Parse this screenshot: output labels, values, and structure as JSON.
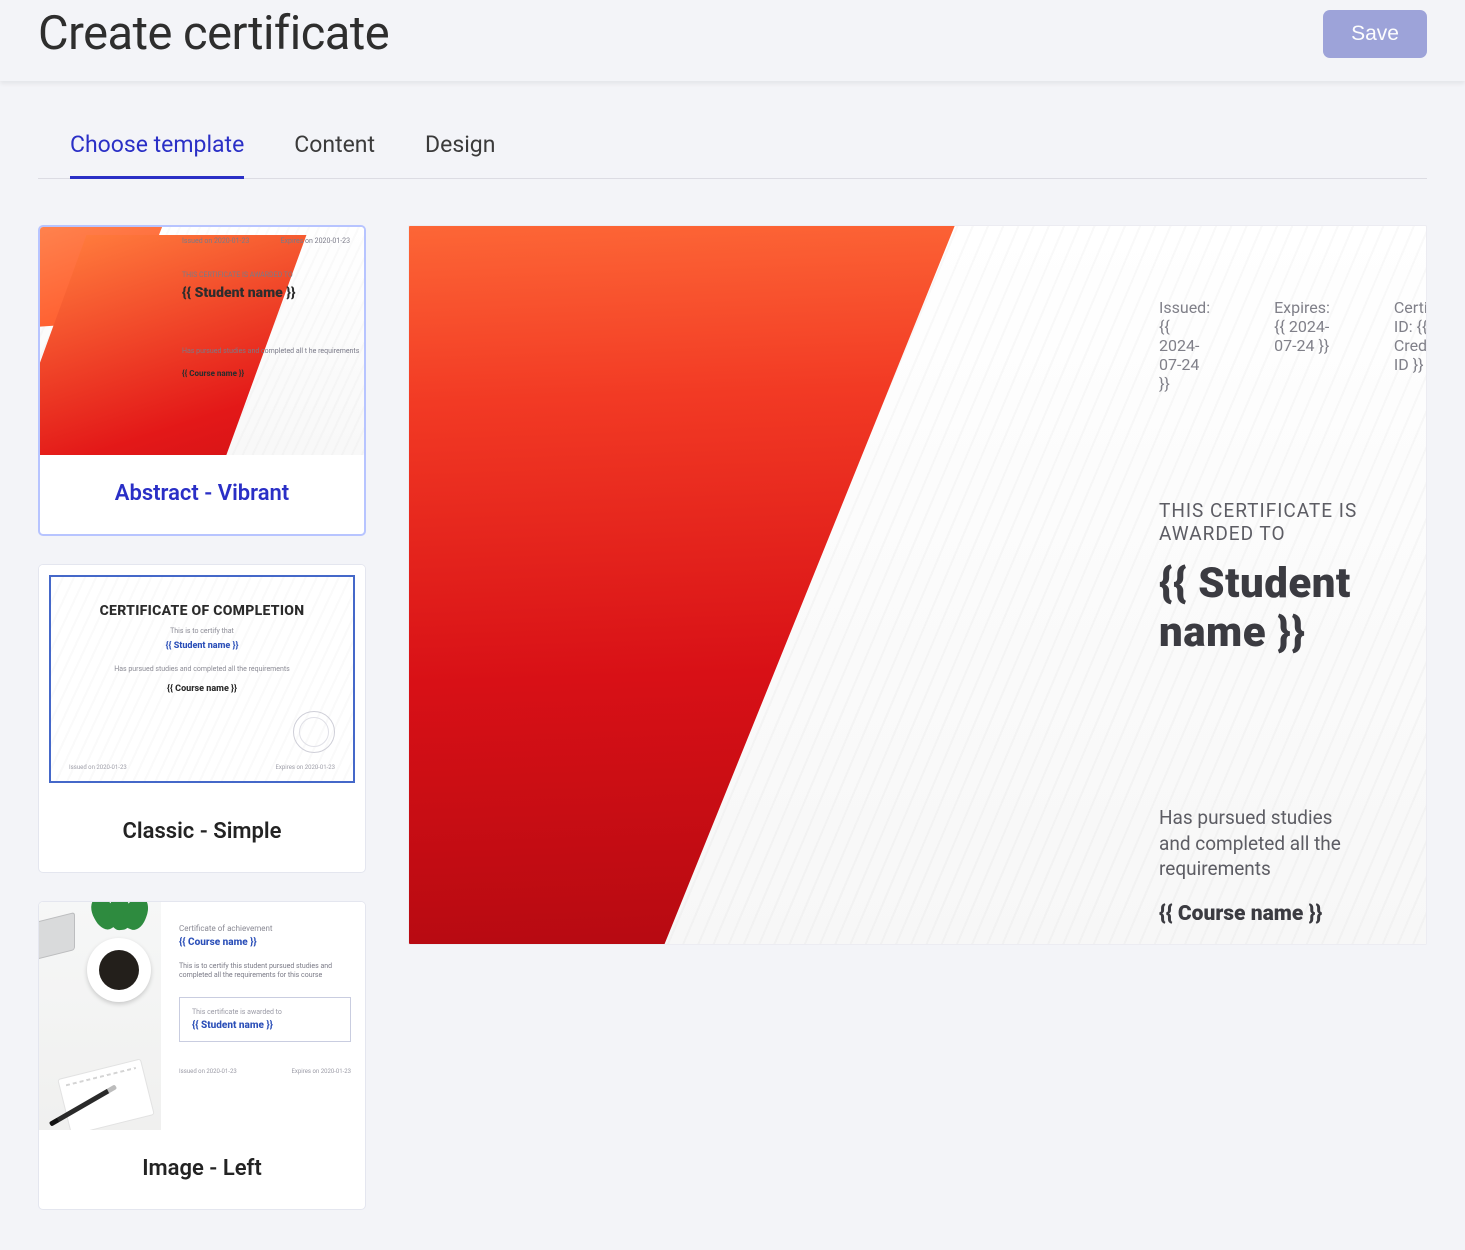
{
  "header": {
    "title": "Create certificate",
    "save_label": "Save"
  },
  "tabs": [
    {
      "label": "Choose template",
      "active": true
    },
    {
      "label": "Content",
      "active": false
    },
    {
      "label": "Design",
      "active": false
    }
  ],
  "templates": [
    {
      "name": "Abstract - Vibrant",
      "selected": true,
      "thumb": {
        "issued": "Issued on 2020-01-23",
        "expires": "Expires on 2020-01-23",
        "award_line": "THIS CERTIFICATE IS AWARDED TO",
        "student": "{{ Student name }}",
        "body": "Has pursued studies and completed all t he requirements",
        "course": "{{ Course name }}"
      }
    },
    {
      "name": "Classic - Simple",
      "selected": false,
      "thumb": {
        "title": "CERTIFICATE OF COMPLETION",
        "sub": "This is to certify that",
        "student": "{{ Student name }}",
        "body": "Has pursued studies and completed all the requirements",
        "course": "{{ Course name }}",
        "issued": "Issued on 2020-01-23",
        "expires": "Expires on 2020-01-23"
      }
    },
    {
      "name": "Image - Left",
      "selected": false,
      "thumb": {
        "sub": "Certificate of achievement",
        "course": "{{ Course name }}",
        "body": "This is to certify this student pursued studies and completed all the requirements for this course",
        "award_line": "This certificate is awarded to",
        "student": "{{ Student name }}",
        "issued": "Issued on 2020-01-23",
        "expires": "Expires on 2020-01-23"
      }
    }
  ],
  "preview": {
    "issued": "Issued: {{ 2024-07-24 }}",
    "expires": "Expires: {{ 2024-07-24 }}",
    "cert_id": "Certificate ID: {{ Credential ID }}",
    "award_line": "THIS CERTIFICATE IS AWARDED TO",
    "student": "{{ Student name }}",
    "body": "Has pursued studies and completed all the requirements",
    "course": "{{ Course name }}"
  }
}
